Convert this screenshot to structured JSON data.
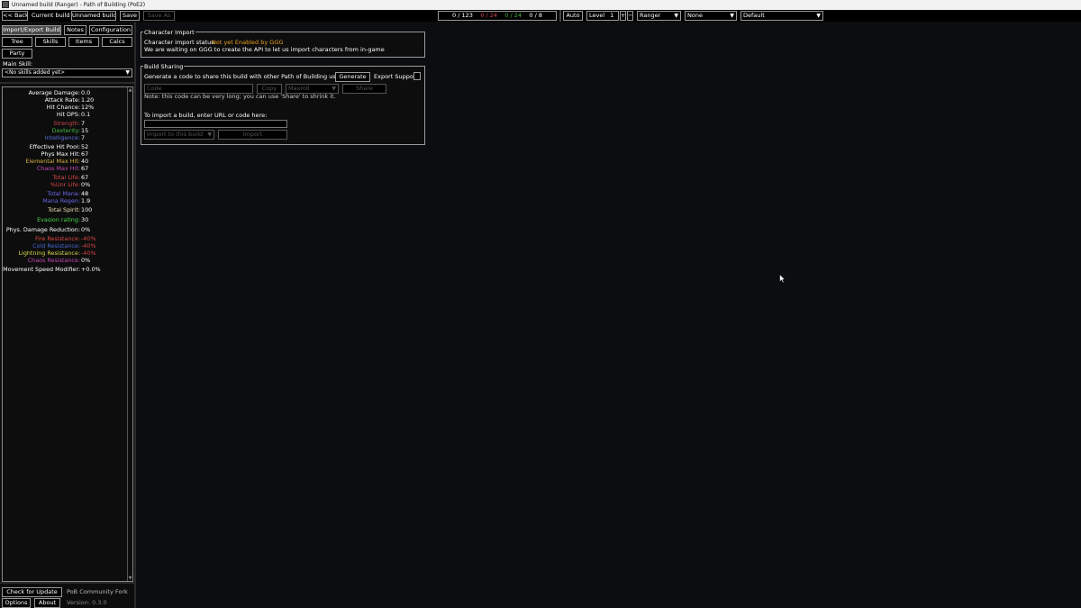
{
  "window": {
    "title": "Unnamed build (Ranger) - Path of Building (PoE2)"
  },
  "topbar": {
    "back": "<< Back",
    "current_build_label": "Current build",
    "build_name": "Unnamed build",
    "save": "Save",
    "save_as": "Save As",
    "points": {
      "passive_used": "0",
      "passive_total": "123",
      "ascend_used": "0",
      "ascend_total": "24",
      "p2_used": "0",
      "p2_total": "24",
      "p3_used": "0",
      "p3_total": "8"
    },
    "auto": "Auto",
    "level_label": "Level",
    "level_value": "1",
    "plus": "+",
    "minus": "−",
    "class": "Ranger",
    "ascendancy": "None",
    "tree_version": "Default"
  },
  "left": {
    "tabs": {
      "import_export": "Import/Export Build",
      "notes": "Notes",
      "configuration": "Configuration",
      "tree": "Tree",
      "skills": "Skills",
      "items": "Items",
      "calcs": "Calcs",
      "party": "Party"
    },
    "main_skill_label": "Main Skill:",
    "main_skill_value": "<No skills added yet>",
    "stats": [
      {
        "label": "Average Damage:",
        "value": "0.0",
        "color": "#ffffff"
      },
      {
        "label": "Attack Rate:",
        "value": "1.20",
        "color": "#ffffff"
      },
      {
        "label": "Hit Chance:",
        "value": "12%",
        "color": "#ffffff"
      },
      {
        "label": "Hit DPS:",
        "value": "0.1",
        "color": "#ffffff"
      },
      {
        "label": "Strength:",
        "value": "7",
        "color": "#c84848"
      },
      {
        "label": "Dexterity:",
        "value": "15",
        "color": "#48b848"
      },
      {
        "label": "Intelligence:",
        "value": "7",
        "color": "#5a6fd8"
      },
      {
        "label": "Effective Hit Pool:",
        "value": "52",
        "color": "#ffffff"
      },
      {
        "label": "Phys Max Hit:",
        "value": "67",
        "color": "#ffffff"
      },
      {
        "label": "Elemental Max Hit:",
        "value": "40",
        "color": "#d8b040"
      },
      {
        "label": "Chaos Max Hit:",
        "value": "67",
        "color": "#c048b8"
      },
      {
        "label": "Total Life:",
        "value": "67",
        "color": "#d84848"
      },
      {
        "label": "%Unr Life:",
        "value": "0%",
        "color": "#d84848"
      },
      {
        "label": "Total Mana:",
        "value": "48",
        "color": "#6868e8"
      },
      {
        "label": "Mana Regen:",
        "value": "1.9",
        "color": "#6868e8"
      },
      {
        "label": "Total Spirit:",
        "value": "100",
        "color": "#e8e0b0"
      },
      {
        "label": "Evasion rating:",
        "value": "30",
        "color": "#48d848"
      },
      {
        "label": "Phys. Damage Reduction:",
        "value": "0%",
        "color": "#ffffff"
      },
      {
        "label": "Fire Resistance:",
        "value": "-40%",
        "color": "#d84848",
        "value_color": "#d84848"
      },
      {
        "label": "Cold Resistance:",
        "value": "-40%",
        "color": "#4868d8",
        "value_color": "#d84848"
      },
      {
        "label": "Lightning Resistance:",
        "value": "-40%",
        "color": "#d8d848",
        "value_color": "#d84848"
      },
      {
        "label": "Chaos Resistance:",
        "value": "0%",
        "color": "#c048b8",
        "value_color": "#ffffff"
      },
      {
        "label": "Movement Speed Modifier:",
        "value": "+0.0%",
        "color": "#ffffff"
      }
    ],
    "check_update": "Check for Update",
    "fork_label": "PoB Community Fork",
    "options": "Options",
    "about": "About",
    "version": "Version: 0.3.0"
  },
  "char_import": {
    "legend": "Character Import",
    "status_label": "Character import status:",
    "status_value": "Not yet Enabled by GGG",
    "status_color": "#e8a020",
    "message": "We are waiting on GGG to create the API to let us import characters from in-game"
  },
  "build_sharing": {
    "legend": "Build Sharing",
    "generate_text": "Generate a code to share this build with other Path of Building users:",
    "generate_btn": "Generate",
    "export_support": "Export Support",
    "code_placeholder": "Code",
    "copy_btn": "Copy",
    "share_site": "Maxroll",
    "share_btn": "Share",
    "note": "Note: this code can be very long; you can use 'Share' to shrink it.",
    "import_label": "To import a build, enter URL or code here:",
    "import_target": "Import to this build",
    "import_btn": "Import"
  }
}
